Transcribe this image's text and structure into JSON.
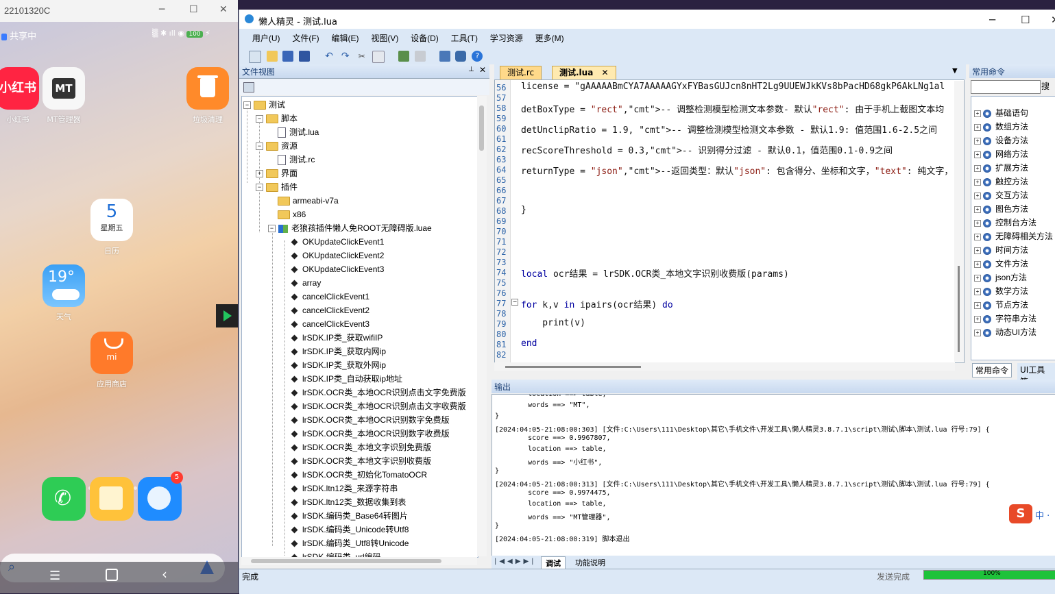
{
  "phone": {
    "window_title": "22101320C",
    "status_left": "共享中",
    "apps_top": [
      {
        "label": "小红书",
        "icon": "xiaohongshu-icon",
        "color": "#ff2442",
        "text": "小红书"
      },
      {
        "label": "MT管理器",
        "icon": "mt-manager-icon",
        "color": "#ffffff",
        "text": "MT"
      },
      {
        "label": "垃圾清理",
        "icon": "trash-icon",
        "color": "#ff8a2a",
        "text": "🗑"
      }
    ],
    "calendar": {
      "day": "5",
      "weekday": "星期五",
      "label": "日历"
    },
    "weather": {
      "temp": "19°",
      "label": "天气"
    },
    "store": {
      "label": "应用商店",
      "text": "mi"
    },
    "dock_badge": "5"
  },
  "ide": {
    "title": "懒人精灵 - 测试.lua",
    "menus": [
      "用户(U)",
      "文件(F)",
      "编辑(E)",
      "视图(V)",
      "设备(D)",
      "工具(T)",
      "学习资源",
      "更多(M)"
    ],
    "file_view_title": "文件视图",
    "tree": [
      {
        "label": "测试",
        "kind": "folder",
        "level": 0
      },
      {
        "label": "脚本",
        "kind": "folder",
        "level": 1
      },
      {
        "label": "测试.lua",
        "kind": "file",
        "level": 2
      },
      {
        "label": "资源",
        "kind": "folder",
        "level": 1
      },
      {
        "label": "测试.rc",
        "kind": "file",
        "level": 2
      },
      {
        "label": "界面",
        "kind": "folder",
        "level": 1
      },
      {
        "label": "插件",
        "kind": "folder",
        "level": 1
      },
      {
        "label": "armeabi-v7a",
        "kind": "folder",
        "level": 2
      },
      {
        "label": "x86",
        "kind": "folder",
        "level": 2
      },
      {
        "label": "老狼孩插件懒人免ROOT无障碍版.luae",
        "kind": "plugin",
        "level": 2
      },
      {
        "label": "OKUpdateClickEvent1",
        "kind": "item",
        "level": 3
      },
      {
        "label": "OKUpdateClickEvent2",
        "kind": "item",
        "level": 3
      },
      {
        "label": "OKUpdateClickEvent3",
        "kind": "item",
        "level": 3
      },
      {
        "label": "array",
        "kind": "item",
        "level": 3
      },
      {
        "label": "cancelClickEvent1",
        "kind": "item",
        "level": 3
      },
      {
        "label": "cancelClickEvent2",
        "kind": "item",
        "level": 3
      },
      {
        "label": "cancelClickEvent3",
        "kind": "item",
        "level": 3
      },
      {
        "label": "lrSDK.IP类_获取wifiIP",
        "kind": "item",
        "level": 3
      },
      {
        "label": "lrSDK.IP类_获取内网ip",
        "kind": "item",
        "level": 3
      },
      {
        "label": "lrSDK.IP类_获取外网ip",
        "kind": "item",
        "level": 3
      },
      {
        "label": "lrSDK.IP类_自动获取ip地址",
        "kind": "item",
        "level": 3
      },
      {
        "label": "lrSDK.OCR类_本地OCR识别点击文字免费版",
        "kind": "item",
        "level": 3
      },
      {
        "label": "lrSDK.OCR类_本地OCR识别点击文字收费版",
        "kind": "item",
        "level": 3
      },
      {
        "label": "lrSDK.OCR类_本地OCR识别数字免费版",
        "kind": "item",
        "level": 3
      },
      {
        "label": "lrSDK.OCR类_本地OCR识别数字收费版",
        "kind": "item",
        "level": 3
      },
      {
        "label": "lrSDK.OCR类_本地文字识别免费版",
        "kind": "item",
        "level": 3
      },
      {
        "label": "lrSDK.OCR类_本地文字识别收费版",
        "kind": "item",
        "level": 3
      },
      {
        "label": "lrSDK.OCR类_初始化TomatoOCR",
        "kind": "item",
        "level": 3
      },
      {
        "label": "lrSDK.ltn12类_来源字符串",
        "kind": "item",
        "level": 3
      },
      {
        "label": "lrSDK.ltn12类_数据收集到表",
        "kind": "item",
        "level": 3
      },
      {
        "label": "lrSDK.编码类_Base64转图片",
        "kind": "item",
        "level": 3
      },
      {
        "label": "lrSDK.编码类_Unicode转Utf8",
        "kind": "item",
        "level": 3
      },
      {
        "label": "lrSDK.编码类_Utf8转Unicode",
        "kind": "item",
        "level": 3
      },
      {
        "label": "lrSDK.编码类_url编码",
        "kind": "item",
        "level": 3
      }
    ],
    "editor_tabs": [
      "测试.rc",
      "测试.lua"
    ],
    "code_lines": [
      {
        "n": "56",
        "text": "license = \"gAAAAABmCYA7AAAAAGYxFYBasGUJcn8nHT2Lg9UUEWJkKVs8bPacHD68gkP6AkLNg1al"
      },
      {
        "n": "57",
        "text": ""
      },
      {
        "n": "58",
        "text": "detBoxType = \"rect\",-- 调整检测模型检测文本参数- 默认\"rect\": 由于手机上截图文本均"
      },
      {
        "n": "59",
        "text": ""
      },
      {
        "n": "60",
        "text": "detUnclipRatio = 1.9, -- 调整检测模型检测文本参数 - 默认1.9: 值范围1.6-2.5之间"
      },
      {
        "n": "61",
        "text": ""
      },
      {
        "n": "62",
        "text": "recScoreThreshold = 0.3,-- 识别得分过滤 - 默认0.1，值范围0.1-0.9之间"
      },
      {
        "n": "63",
        "text": ""
      },
      {
        "n": "64",
        "text": "returnType = \"json\",--返回类型：默认\"json\": 包含得分、坐标和文字，\"text\": 纯文字，"
      },
      {
        "n": "65",
        "text": ""
      },
      {
        "n": "66",
        "text": ""
      },
      {
        "n": "67",
        "text": ""
      },
      {
        "n": "68",
        "text": "}"
      },
      {
        "n": "69",
        "text": ""
      },
      {
        "n": "70",
        "text": ""
      },
      {
        "n": "71",
        "text": ""
      },
      {
        "n": "72",
        "text": ""
      },
      {
        "n": "73",
        "text": ""
      },
      {
        "n": "74",
        "text": "local ocr结果 = lrSDK.OCR类_本地文字识别收费版(params)"
      },
      {
        "n": "75",
        "text": ""
      },
      {
        "n": "76",
        "text": ""
      },
      {
        "n": "77",
        "text": "for k,v in ipairs(ocr结果) do"
      },
      {
        "n": "78",
        "text": ""
      },
      {
        "n": "79",
        "text": "    print(v)"
      },
      {
        "n": "80",
        "text": ""
      },
      {
        "n": "81",
        "text": "end"
      },
      {
        "n": "82",
        "text": ""
      }
    ],
    "right_panel_title": "常用命令",
    "right_search_button": "搜",
    "commands": [
      "基础语句",
      "数组方法",
      "设备方法",
      "网络方法",
      "扩展方法",
      "触控方法",
      "交互方法",
      "图色方法",
      "控制台方法",
      "无障碍相关方法",
      "时间方法",
      "文件方法",
      "json方法",
      "数学方法",
      "节点方法",
      "字符串方法",
      "动态UI方法"
    ],
    "right_tabs": [
      "常用命令",
      "UI工具箱"
    ],
    "output_title": "输出",
    "output_lines": [
      "        location ==> table,",
      "        words ==> \"MT\",",
      "}",
      "[2024:04:05-21:08:00:303] [文件:C:\\Users\\111\\Desktop\\其它\\手机文件\\开发工具\\懒人精灵3.8.7.1\\script\\测试\\脚本\\测试.lua 行号:79] {",
      "        score ==> 0.9967807,",
      "        location ==> table,",
      "        words ==> \"小红书\",",
      "}",
      "[2024:04:05-21:08:00:313] [文件:C:\\Users\\111\\Desktop\\其它\\手机文件\\开发工具\\懒人精灵3.8.7.1\\script\\测试\\脚本\\测试.lua 行号:79] {",
      "        score ==> 0.9974475,",
      "        location ==> table,",
      "        words ==> \"MT管理器\",",
      "}",
      "[2024:04:05-21:08:00:319] 脚本退出"
    ],
    "output_tabs": [
      "调试",
      "功能说明"
    ],
    "status_left": "完成",
    "status_send": "发送完成",
    "progress_label": "100%",
    "progress": 1.0
  }
}
